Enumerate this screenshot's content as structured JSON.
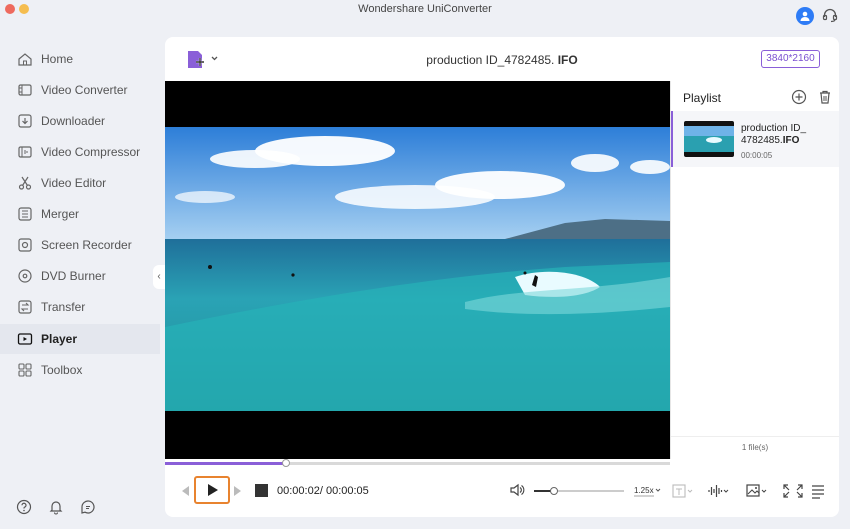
{
  "app": {
    "title": "Wondershare UniConverter"
  },
  "sidebar": {
    "items": [
      {
        "label": "Home",
        "icon": "home-icon",
        "active": false
      },
      {
        "label": "Video Converter",
        "icon": "video-converter-icon",
        "active": false
      },
      {
        "label": "Downloader",
        "icon": "downloader-icon",
        "active": false
      },
      {
        "label": "Video Compressor",
        "icon": "compressor-icon",
        "active": false
      },
      {
        "label": "Video Editor",
        "icon": "scissors-icon",
        "active": false
      },
      {
        "label": "Merger",
        "icon": "merger-icon",
        "active": false
      },
      {
        "label": "Screen Recorder",
        "icon": "screen-recorder-icon",
        "active": false
      },
      {
        "label": "DVD Burner",
        "icon": "disc-icon",
        "active": false
      },
      {
        "label": "Transfer",
        "icon": "transfer-icon",
        "active": false
      },
      {
        "label": "Player",
        "icon": "player-icon",
        "active": true
      },
      {
        "label": "Toolbox",
        "icon": "toolbox-icon",
        "active": false
      }
    ]
  },
  "player": {
    "file_title_prefix": "production ID_4782485. ",
    "file_title_ext": "IFO",
    "resolution": "3840*2160",
    "current_time": "00:00:02",
    "time_separator": "/ ",
    "total_time": "00:00:05",
    "progress": 0.24,
    "volume": 0.22,
    "speed": "1.25x"
  },
  "playlist": {
    "title": "Playlist",
    "items": [
      {
        "name_line1": "production ID_",
        "name_line2_prefix": "4782485.",
        "name_line2_ext": "IFO",
        "duration": "00:00:05"
      }
    ],
    "file_count": "1 file(s)"
  },
  "colors": {
    "accent": "#8a5fd8",
    "play_highlight": "#e8832f",
    "user": "#2e7cf6"
  }
}
